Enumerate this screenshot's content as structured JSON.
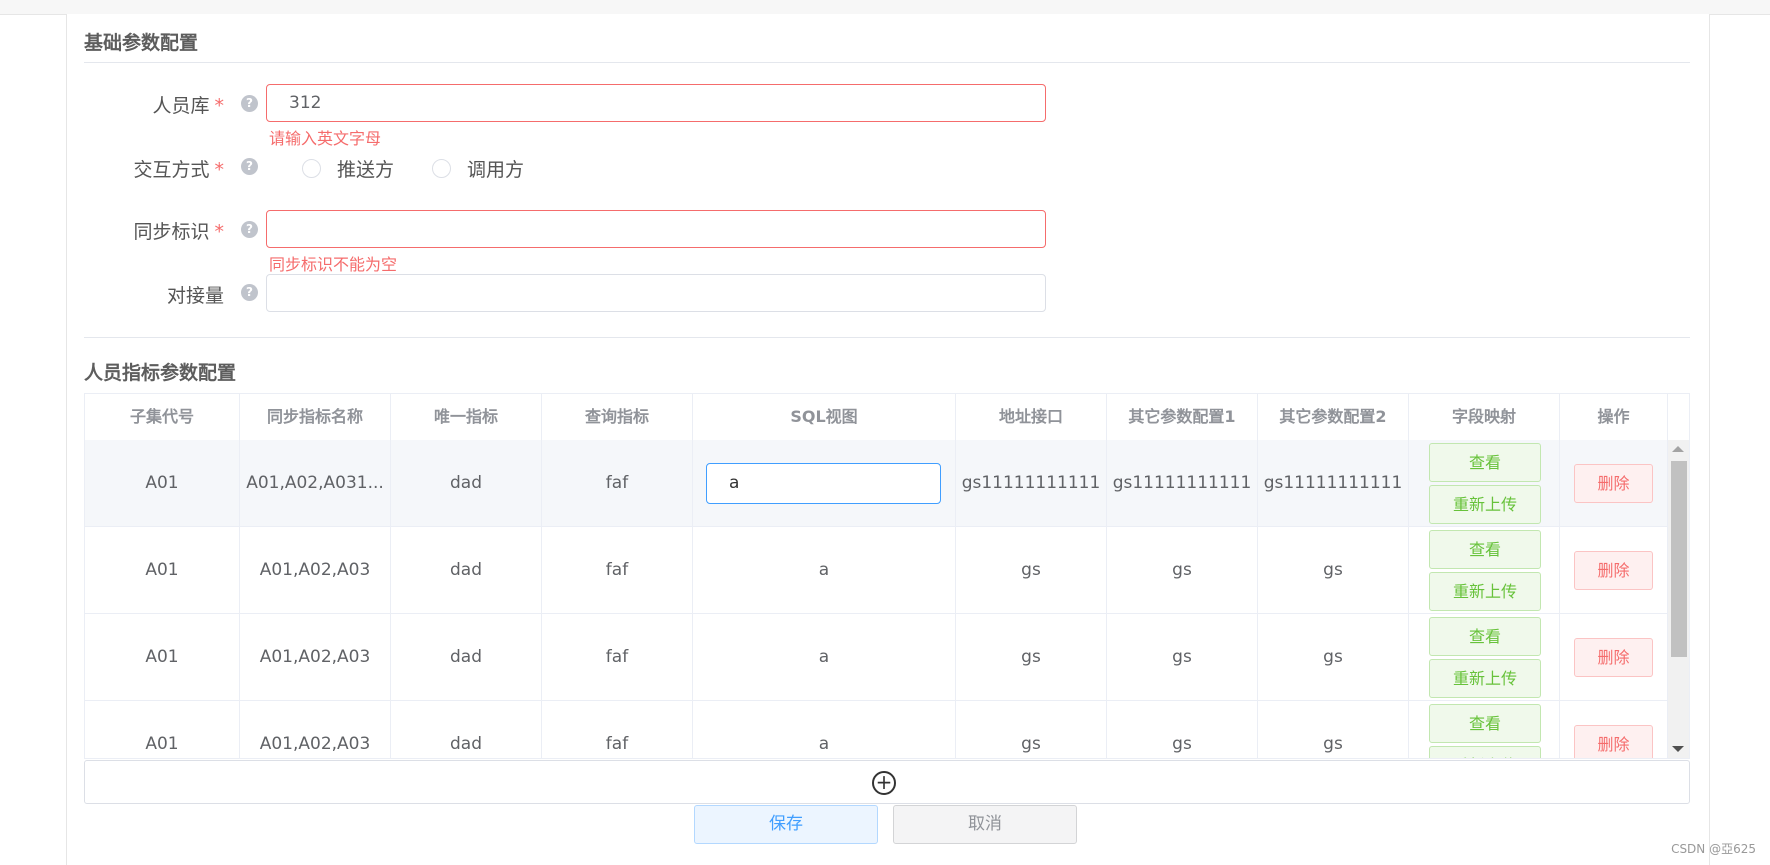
{
  "sections": {
    "basic_title": "基础参数配置",
    "indicator_title": "人员指标参数配置"
  },
  "form": {
    "personnel_db": {
      "label": "人员库",
      "value": "312",
      "error": "请输入英文字母"
    },
    "interaction": {
      "label": "交互方式",
      "options": [
        "推送方",
        "调用方"
      ]
    },
    "sync_id": {
      "label": "同步标识",
      "value": "",
      "error": "同步标识不能为空"
    },
    "docking": {
      "label": "对接量",
      "value": ""
    },
    "required_mark": "*",
    "help_icon": "question-circle-icon"
  },
  "table": {
    "columns": [
      "子集代号",
      "同步指标名称",
      "唯一指标",
      "查询指标",
      "SQL视图",
      "地址接口",
      "其它参数配置1",
      "其它参数配置2",
      "字段映射",
      "操作"
    ],
    "rows": [
      {
        "subset": "A01",
        "sync_name": "A01,A02,A031...",
        "unique": "dad",
        "query": "faf",
        "sql": "a",
        "address": "gs11111111111",
        "other1": "gs11111111111",
        "other2": "gs11111111111"
      },
      {
        "subset": "A01",
        "sync_name": "A01,A02,A03",
        "unique": "dad",
        "query": "faf",
        "sql": "a",
        "address": "gs",
        "other1": "gs",
        "other2": "gs"
      },
      {
        "subset": "A01",
        "sync_name": "A01,A02,A03",
        "unique": "dad",
        "query": "faf",
        "sql": "a",
        "address": "gs",
        "other1": "gs",
        "other2": "gs"
      },
      {
        "subset": "A01",
        "sync_name": "A01,A02,A03",
        "unique": "dad",
        "query": "faf",
        "sql": "a",
        "address": "gs",
        "other1": "gs",
        "other2": "gs"
      }
    ],
    "view_label": "查看",
    "reupload_label": "重新上传",
    "delete_label": "删除"
  },
  "actions": {
    "add_icon": "plus-circle-icon",
    "save": "保存",
    "cancel": "取消"
  },
  "watermark": "CSDN @亞625",
  "colors": {
    "error": "#f56c6c",
    "primary": "#409eff",
    "success": "#67c23a"
  }
}
